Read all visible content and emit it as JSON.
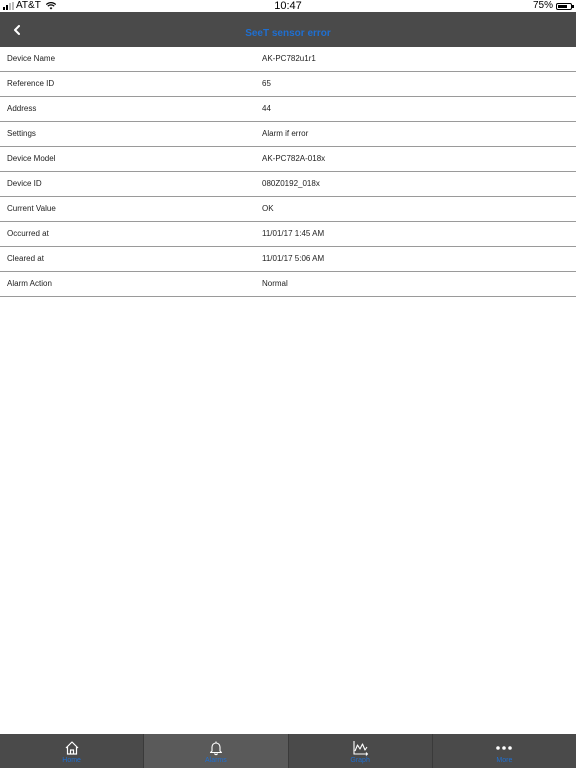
{
  "status_bar": {
    "carrier": "AT&T",
    "time": "10:47",
    "battery": "75%",
    "battery_level": 0.75
  },
  "header": {
    "title": "SeeT sensor error",
    "back_icon": "chevron-left-icon"
  },
  "details": [
    {
      "label": "Device Name",
      "value": "AK-PC782u1r1"
    },
    {
      "label": "Reference ID",
      "value": "65"
    },
    {
      "label": "Address",
      "value": "44"
    },
    {
      "label": "Settings",
      "value": "Alarm if error"
    },
    {
      "label": "Device Model",
      "value": "AK-PC782A-018x"
    },
    {
      "label": "Device ID",
      "value": "080Z0192_018x"
    },
    {
      "label": "Current Value",
      "value": "OK"
    },
    {
      "label": "Occurred at",
      "value": "11/01/17 1:45 AM"
    },
    {
      "label": "Cleared at",
      "value": "11/01/17 5:06 AM"
    },
    {
      "label": "Alarm Action",
      "value": "Normal"
    }
  ],
  "tabs": [
    {
      "label": "Home",
      "icon": "home-icon",
      "active": false
    },
    {
      "label": "Alarms",
      "icon": "bell-icon",
      "active": true
    },
    {
      "label": "Graph",
      "icon": "graph-icon",
      "active": false
    },
    {
      "label": "More",
      "icon": "more-icon",
      "active": false
    }
  ],
  "colors": {
    "accent": "#1f6fd1",
    "bar_background": "#4a4a4a",
    "active_tab": "#5a5a5a"
  }
}
